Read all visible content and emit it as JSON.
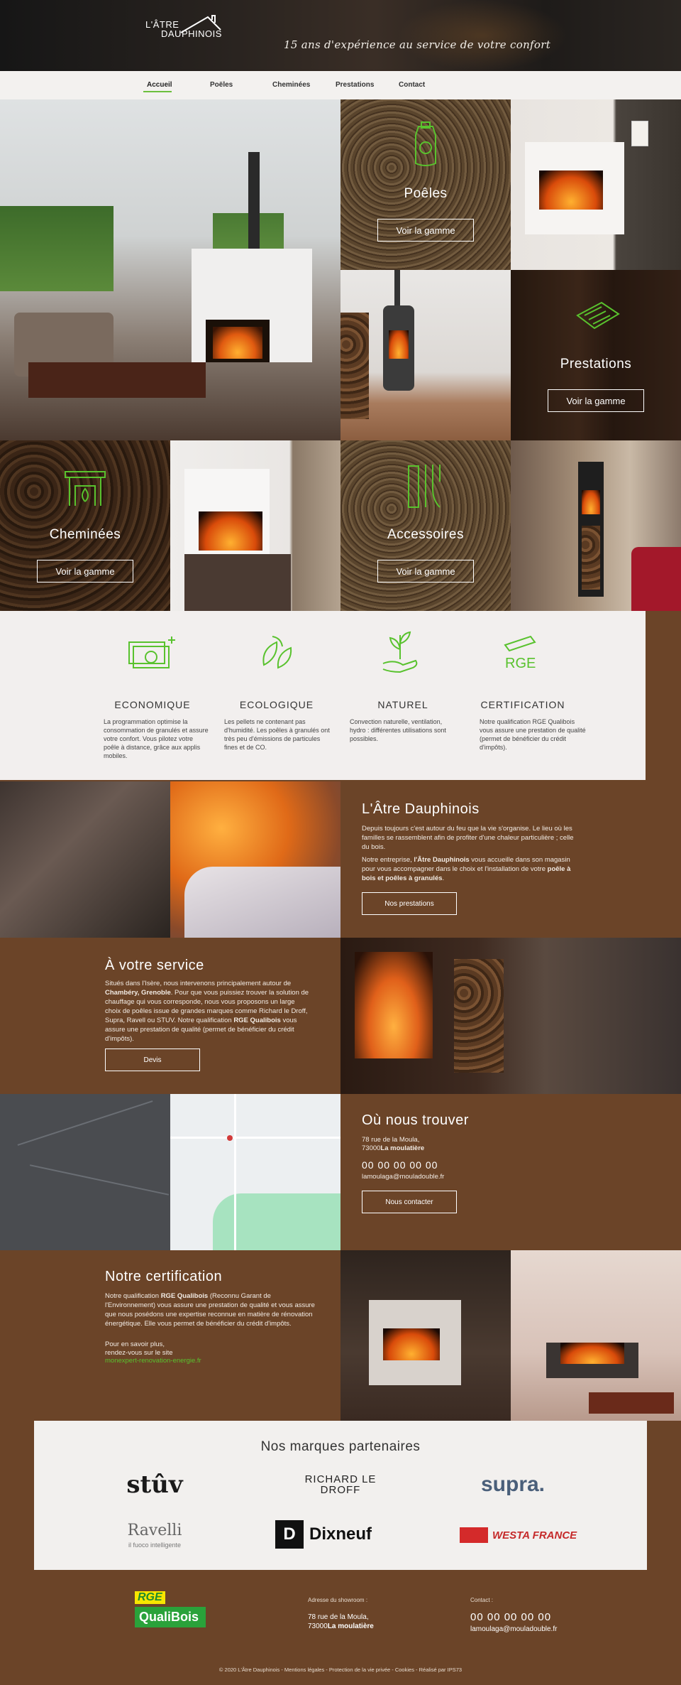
{
  "header": {
    "logo_line1": "L'ÂTRE",
    "logo_line2": "DAUPHINOIS",
    "tagline": "15 ans d'expérience au service de votre confort"
  },
  "nav": {
    "items": [
      "Accueil",
      "Poëles",
      "Cheminées",
      "Prestations",
      "Contact"
    ]
  },
  "tiles": {
    "poeles": {
      "title": "Poêles",
      "button": "Voir la gamme"
    },
    "prestations": {
      "title": "Prestations",
      "button": "Voir la gamme"
    },
    "cheminees": {
      "title": "Cheminées",
      "button": "Voir la gamme"
    },
    "accessoires": {
      "title": "Accessoires",
      "button": "Voir la gamme"
    }
  },
  "features": [
    {
      "title": "ECONOMIQUE",
      "text": "La programmation optimise la consommation de granulés et assure votre confort. Vous pilotez votre poêle à distance, grâce aux applis mobiles.",
      "icon": "money-icon"
    },
    {
      "title": "ECOLOGIQUE",
      "text": "Les pellets ne contenant pas d'humidité. Les poêles à granulés ont très peu d'émissions de particules fines et de CO.",
      "icon": "leaves-icon"
    },
    {
      "title": "NATUREL",
      "text": "Convection naturelle, ventilation, hydro : différentes utilisations sont possibles.",
      "icon": "plant-hand-icon"
    },
    {
      "title": "CERTIFICATION",
      "text": "Notre qualification RGE Qualibois vous assure une prestation de qualité (permet de bénéficier du crédit d'impôts).",
      "icon": "rge-icon"
    }
  ],
  "about": {
    "title": "L'Âtre Dauphinois",
    "p1": "Depuis toujours c'est autour du feu que la vie s'organise. Le lieu où les familles se rassemblent afin de profiter d'une chaleur particulière ; celle du bois.",
    "p2_a": "Notre entreprise, ",
    "p2_b": "l'Âtre Dauphinois",
    "p2_c": " vous accueille dans son magasin pour vous accompagner dans le choix et l'installation de votre ",
    "p2_d": "poêle à bois et poêles à granulés",
    "p2_e": ".",
    "button": "Nos prestations"
  },
  "service": {
    "title": "À votre service",
    "t1": "Situés dans l'Isère, nous intervenons principalement autour de ",
    "t2": "Chambéry, Grenoble",
    "t3": ". Pour que vous puissiez trouver la solution de chauffage qui vous corresponde, nous vous proposons un large choix de poêles issue de grandes marques comme Richard le Droff, Supra, Ravell ou STUV. Notre qualification ",
    "t4": "RGE Qualibois",
    "t5": " vous assure une prestation de qualité (permet de bénéficier du crédit d'impôts).",
    "button": "Devis"
  },
  "location": {
    "title": "Où nous trouver",
    "address1": "78 rue de la Moula,",
    "address2_a": "73000",
    "address2_b": "La moulatière",
    "phone": "00 00 00 00 00",
    "email": "lamoulaga@mouladouble.fr",
    "button": "Nous contacter"
  },
  "certification": {
    "title": "Notre certification",
    "t1": "Notre qualification ",
    "t2": "RGE Qualibois",
    "t3": " (Reconnu Garant de l'Environnement) vous assure une prestation de qualité et vous assure que nous posédons une expertise reconnue en matière de rénovation énergétique. Elle vous permet de bénéficier du crédit d'impôts.",
    "t4": "Pour en savoir plus,",
    "t5": "rendez-vous sur le site",
    "link": "monexpert-renovation-energie.fr"
  },
  "brands": {
    "title": "Nos marques partenaires",
    "items": [
      "stûv",
      "RICHARD LE DROFF",
      "supra.",
      "Ravelli",
      "il fuoco intelligente",
      "Dixneuf",
      "WESTA FRANCE"
    ]
  },
  "footer": {
    "logo_top": "RGE",
    "logo_bottom": "QualiBois",
    "showroom_label": "Adresse du showroom :",
    "address1": "78 rue de la Moula,",
    "address2_a": "73000",
    "address2_b": "La moulatière",
    "contact_label": "Contact :",
    "phone": "00 00 00 00 00",
    "email": "lamoulaga@mouladouble.fr",
    "copyright": "© 2020 L'Âtre Dauphinois - Mentions légales - Protection de la vie privée - Cookies - Réalisé par IPS73"
  },
  "colors": {
    "accent": "#59c22e",
    "brown": "#6b4428",
    "light": "#f2efee"
  }
}
